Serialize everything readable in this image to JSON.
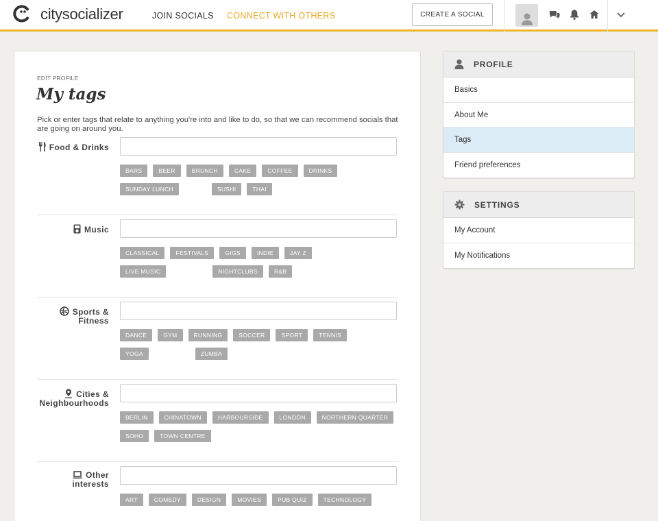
{
  "header": {
    "logo_text": "citysocializer",
    "nav": {
      "join": "JOIN SOCIALS",
      "connect": "CONNECT WITH OTHERS"
    },
    "create_button": "CREATE A SOCIAL",
    "icons": [
      "avatar-icon",
      "chat-icon",
      "bell-icon",
      "home-icon",
      "chevron-down-icon"
    ],
    "colors": {
      "accent": "#f0b429",
      "active_nav": "#e9a826"
    }
  },
  "main": {
    "breadcrumb": "EDIT PROFILE",
    "title": "My tags",
    "intro": "Pick or enter tags that relate to anything you're into and like to do, so that we can recommend socials that are going on around you.",
    "sections": [
      {
        "label": "Food & Drinks",
        "icon": "fork-knife-icon",
        "tags": [
          "BARS",
          "BEER",
          "BRUNCH",
          "CAKE",
          "COFFEE",
          "DRINKS",
          "SUNDAY LUNCH",
          "SUSHI",
          "THAI"
        ]
      },
      {
        "label": "Music",
        "icon": "music-player-icon",
        "tags": [
          "CLASSICAL",
          "FESTIVALS",
          "GIGS",
          "INDIE",
          "JAY Z",
          "LIVE MUSIC",
          "NIGHTCLUBS",
          "R&B"
        ]
      },
      {
        "label": "Sports & Fitness",
        "icon": "ball-icon",
        "tags": [
          "DANCE",
          "GYM",
          "RUNNING",
          "SOCCER",
          "SPORT",
          "TENNIS",
          "YOGA",
          "ZUMBA"
        ]
      },
      {
        "label": "Cities & Neighbourhoods",
        "icon": "map-pin-icon",
        "tags": [
          "BERLIN",
          "CHINATOWN",
          "HARBOURSIDE",
          "LONDON",
          "NORTHERN QUARTER",
          "SOHO",
          "TOWN CENTRE"
        ]
      },
      {
        "label": "Other interests",
        "icon": "laptop-icon",
        "tags": [
          "ART",
          "COMEDY",
          "DESIGN",
          "MOVIES",
          "PUB QUIZ",
          "TECHNOLOGY"
        ]
      }
    ]
  },
  "sidebar": {
    "profile": {
      "title": "PROFILE",
      "items": [
        "Basics",
        "About Me",
        "Tags",
        "Friend preferences"
      ],
      "active": "Tags"
    },
    "settings": {
      "title": "SETTINGS",
      "items": [
        "My Account",
        "My Notifications"
      ]
    }
  }
}
